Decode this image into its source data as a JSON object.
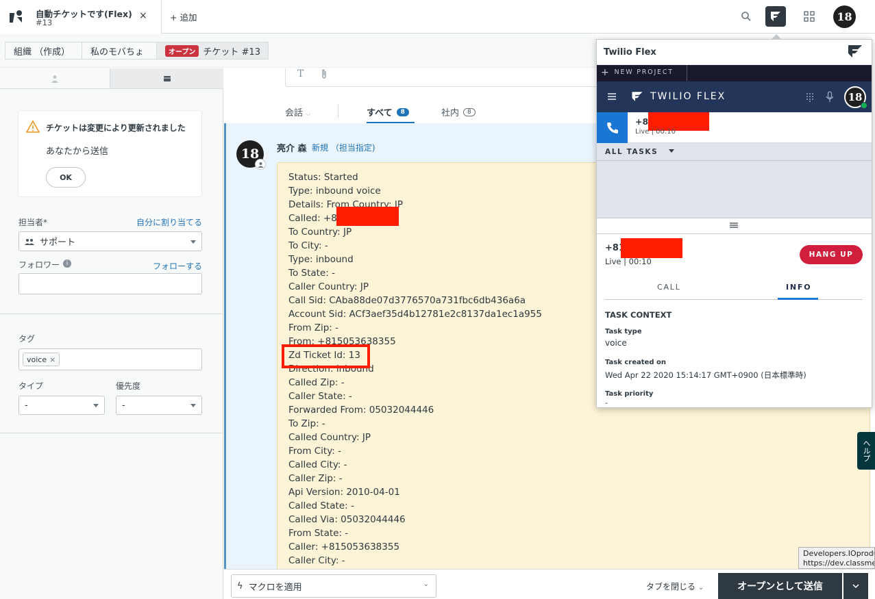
{
  "topbar": {
    "tab_title": "自動チケットです(Flex)",
    "tab_subtitle": "#13",
    "close_glyph": "×",
    "add_label": "+ 追加",
    "avatar_text": "18"
  },
  "breadcrumbs": {
    "org": "組織 （作成）",
    "user": "私のモバちょ",
    "status_badge": "オープン",
    "ticket": "チケット #13"
  },
  "sidebar": {
    "notice_title": "チケットは変更により更新されました",
    "notice_body": "あなたから送信",
    "ok_label": "OK",
    "assignee_label": "担当者*",
    "assign_self_link": "自分に割り当てる",
    "assignee_value": "サポート",
    "follower_label": "フォロワー",
    "follow_link": "フォローする",
    "tags_label": "タグ",
    "tag_value": "voice",
    "type_label": "タイプ",
    "type_value": "-",
    "priority_label": "優先度",
    "priority_value": "-"
  },
  "conversation": {
    "filter_label": "会話",
    "tab_all": "すべて",
    "tab_all_count": "8",
    "tab_internal": "社内",
    "tab_internal_count": "8",
    "author": "亮介 森",
    "author_meta": "新規 （担当指定)",
    "lines": [
      "Status: Started",
      "Type: inbound voice",
      "Details: From Country: JP",
      "Called: +81",
      "To Country: JP",
      "To City: -",
      "Type: inbound",
      "To State: -",
      "Caller Country: JP",
      "Call Sid: CAba88de07d3776570a731fbc6db436a6a",
      "Account Sid: ACf3aef35d4b12781e2c8137da1ec1a955",
      "From Zip: -",
      "From: +815053638355",
      "Zd Ticket Id: 13",
      "Direction: inbound",
      "Called Zip: -",
      "Caller State: -",
      "Forwarded From: 05032044446",
      "To Zip: -",
      "Called Country: JP",
      "From City: -",
      "Called City: -",
      "Caller Zip: -",
      "Api Version: 2010-04-01",
      "Called State: -",
      "Called Via: 05032044446",
      "From State: -",
      "Caller: +815053638355",
      "Caller City: -"
    ]
  },
  "bottombar": {
    "macro_label": "マクロを適用",
    "close_tab_label": "タブを閉じる",
    "submit_label": "オープンとして送信"
  },
  "flex": {
    "panel_title": "Twilio Flex",
    "new_project": "NEW PROJECT",
    "brand": "TWILIO FLEX",
    "task_number": "+81",
    "task_status": "Live | 00:10",
    "all_tasks": "ALL TASKS",
    "call_number": "+81",
    "call_status": "Live | 00:10",
    "hangup_label": "HANG UP",
    "tab_call": "CALL",
    "tab_info": "INFO",
    "context_title": "TASK CONTEXT",
    "task_type_label": "Task type",
    "task_type_value": "voice",
    "task_created_label": "Task created on",
    "task_created_value": "Wed Apr 22 2020 15:14:17 GMT+0900 (日本標準時)",
    "task_priority_label": "Task priority",
    "task_priority_value": "-"
  },
  "help_label": "ヘルプ",
  "tooltip": {
    "line1": "Developers.IOproduct",
    "line2": "https://dev.classmethod"
  },
  "colors": {
    "accent": "#1f73b7",
    "flex_nav": "#233659",
    "hangup": "#d01f3c",
    "open_badge": "#cc3340",
    "highlight_box": "#ff1d00"
  }
}
